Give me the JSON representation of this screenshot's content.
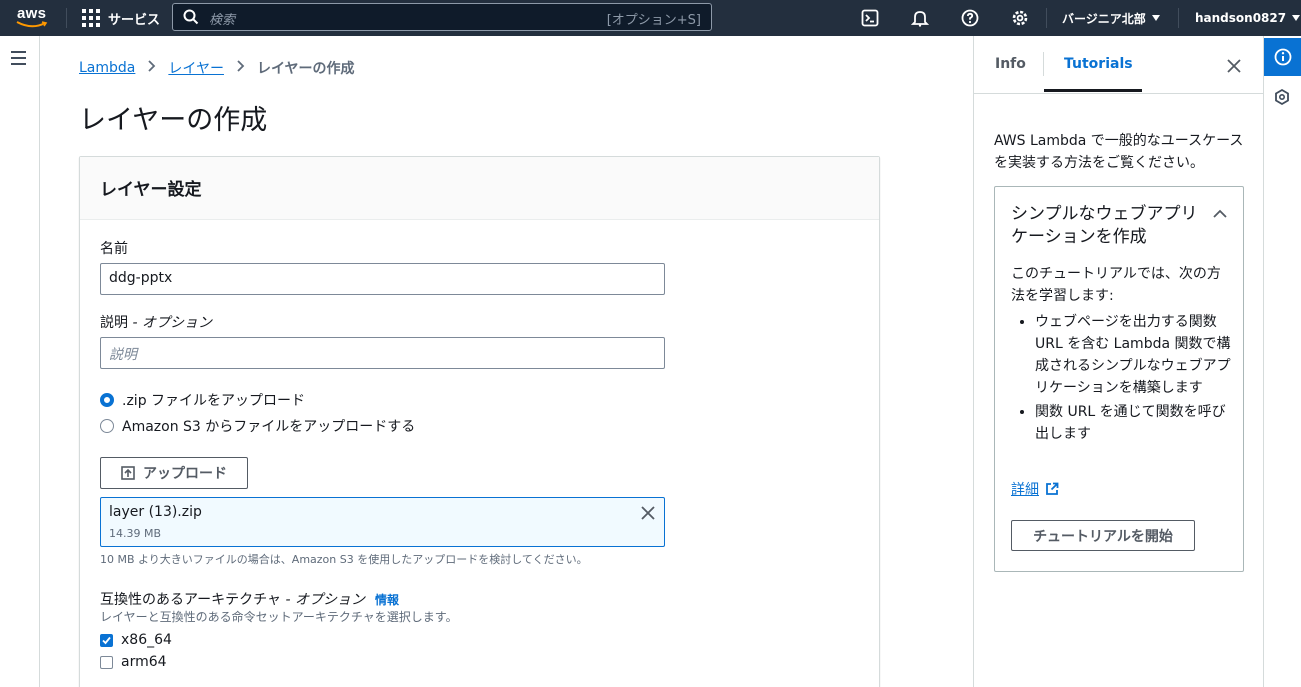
{
  "topnav": {
    "logo_text": "aws",
    "services_label": "サービス",
    "search_placeholder": "検索",
    "search_shortcut": "[オプション+S]",
    "region": "バージニア北部",
    "user": "handson0827"
  },
  "breadcrumb": {
    "items": [
      "Lambda",
      "レイヤー"
    ],
    "current": "レイヤーの作成"
  },
  "page": {
    "title": "レイヤーの作成"
  },
  "panel": {
    "title": "レイヤー設定",
    "name_label": "名前",
    "name_value": "ddg-pptx",
    "desc_label": "説明",
    "desc_label_suffix": "- オプション",
    "desc_placeholder": "説明",
    "radio_zip": ".zip ファイルをアップロード",
    "radio_s3": "Amazon S3 からファイルをアップロードする",
    "upload_button": "アップロード",
    "file_name": "layer (13).zip",
    "file_size": "14.39 MB",
    "hint": "10 MB より大きいファイルの場合は、Amazon S3 を使用したアップロードを検討してください。",
    "arch_title": "互換性のあるアーキテクチャ",
    "arch_title_suffix": "- オプション",
    "arch_info": "情報",
    "arch_desc": "レイヤーと互換性のある命令セットアーキテクチャを選択します。",
    "arch_options": [
      {
        "label": "x86_64",
        "checked": true
      },
      {
        "label": "arm64",
        "checked": false
      }
    ]
  },
  "help_panel": {
    "tabs": [
      "Info",
      "Tutorials"
    ],
    "active_tab": "Tutorials",
    "intro": "AWS Lambda で一般的なユースケースを実装する方法をご覧ください。",
    "tutorial": {
      "title": "シンプルなウェブアプリケーションを作成",
      "description": "このチュートリアルでは、次の方法を学習します:",
      "bullets": [
        "ウェブページを出力する関数 URL を含む Lambda 関数で構成されるシンプルなウェブアプリケーションを構築します",
        "関数 URL を通じて関数を呼び出します"
      ],
      "more_link": "詳細",
      "start_button": "チュートリアルを開始"
    }
  },
  "colors": {
    "nav_bg": "#232f3e",
    "link": "#0972d3",
    "text": "#16191f"
  }
}
